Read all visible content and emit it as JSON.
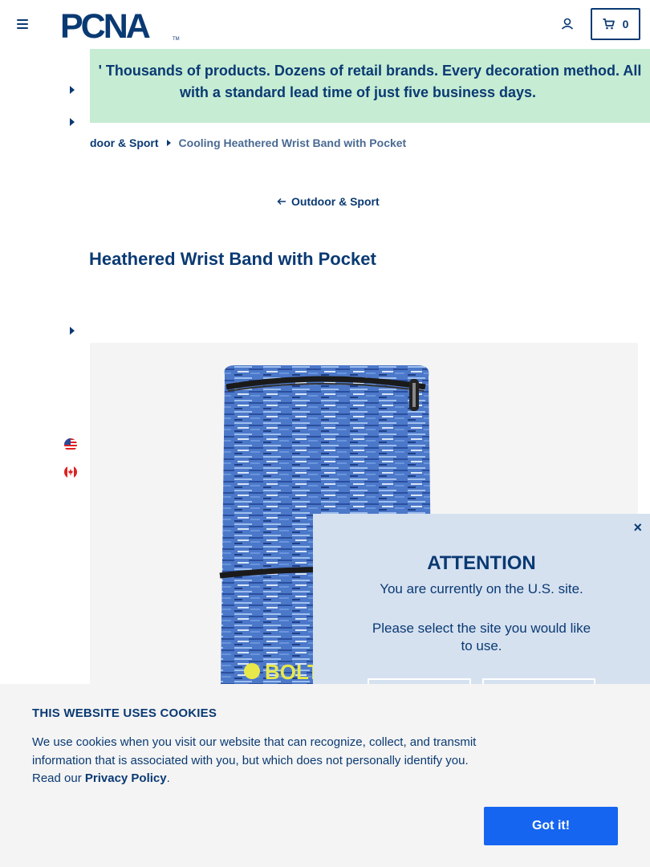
{
  "header": {
    "logo_text": "PCNA",
    "logo_tm": "TM",
    "cart_count": "0"
  },
  "promo": {
    "line1": "' Thousands of products. Dozens of retail brands. Every decoration method. All",
    "line2": "with a standard lead time of just five business days.",
    "background": "#c6ecd3"
  },
  "breadcrumb": {
    "parent": "door & Sport",
    "current": "Cooling Heathered Wrist Band with Pocket"
  },
  "back_link": "Outdoor & Sport",
  "product": {
    "title": "Heathered Wrist Band with Pocket",
    "image_brand_text": "BOLT"
  },
  "attention_modal": {
    "close": "×",
    "title": "ATTENTION",
    "message": "You are currently on the U.S. site.",
    "prompt": "Please select the site you would like to use."
  },
  "cookies": {
    "title": "THIS WEBSITE USES COOKIES",
    "text": "We use cookies when you visit our website that can recognize, collect, and transmit information that is associated with you, but which does not personally identify you. Read our ",
    "link": "Privacy Policy",
    "after_link": ".",
    "accept": "Got it!"
  },
  "colors": {
    "brand_navy": "#0a3a73",
    "accent_blue": "#1565f0",
    "modal_bg": "#d6e1f0"
  },
  "icons": [
    "hamburger-icon",
    "user-icon",
    "cart-icon",
    "arrow-left-icon",
    "us-flag-icon",
    "canada-flag-icon",
    "close-icon"
  ]
}
